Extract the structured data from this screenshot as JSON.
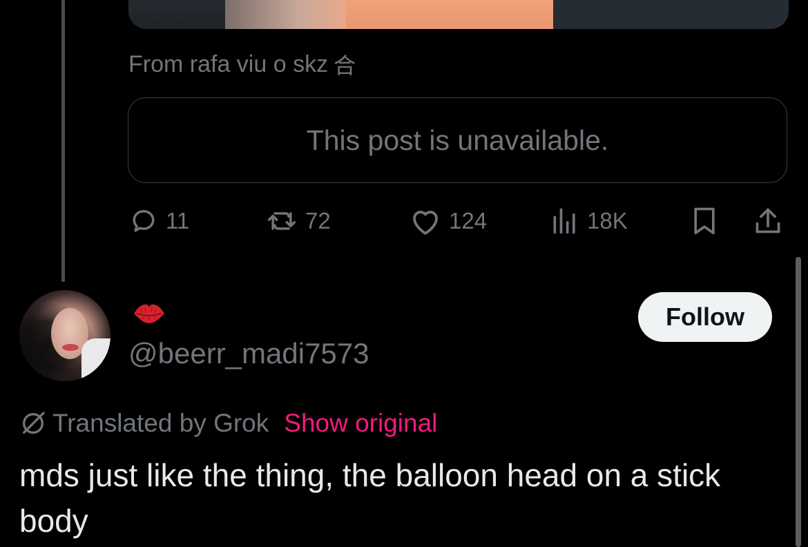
{
  "quoted_post": {
    "from_text": "From rafa viu o skz",
    "from_icon": "cjk-character-icon",
    "unavailable_text": "This post is unavailable.",
    "actions": {
      "replies": "11",
      "reposts": "72",
      "likes": "124",
      "views": "18K"
    }
  },
  "reply": {
    "display_name_icon": "kiss-lips-icon",
    "handle": "@beerr_madi7573",
    "follow_label": "Follow",
    "translated_by": "Translated by Grok",
    "show_original": "Show original",
    "text": "mds just like the thing, the balloon head on a stick body"
  },
  "colors": {
    "background": "#000000",
    "text_primary": "#e7e9ea",
    "text_secondary": "#71767b",
    "accent_pink": "#f91880",
    "follow_bg": "#eff3f4",
    "border": "#3a3e42"
  }
}
